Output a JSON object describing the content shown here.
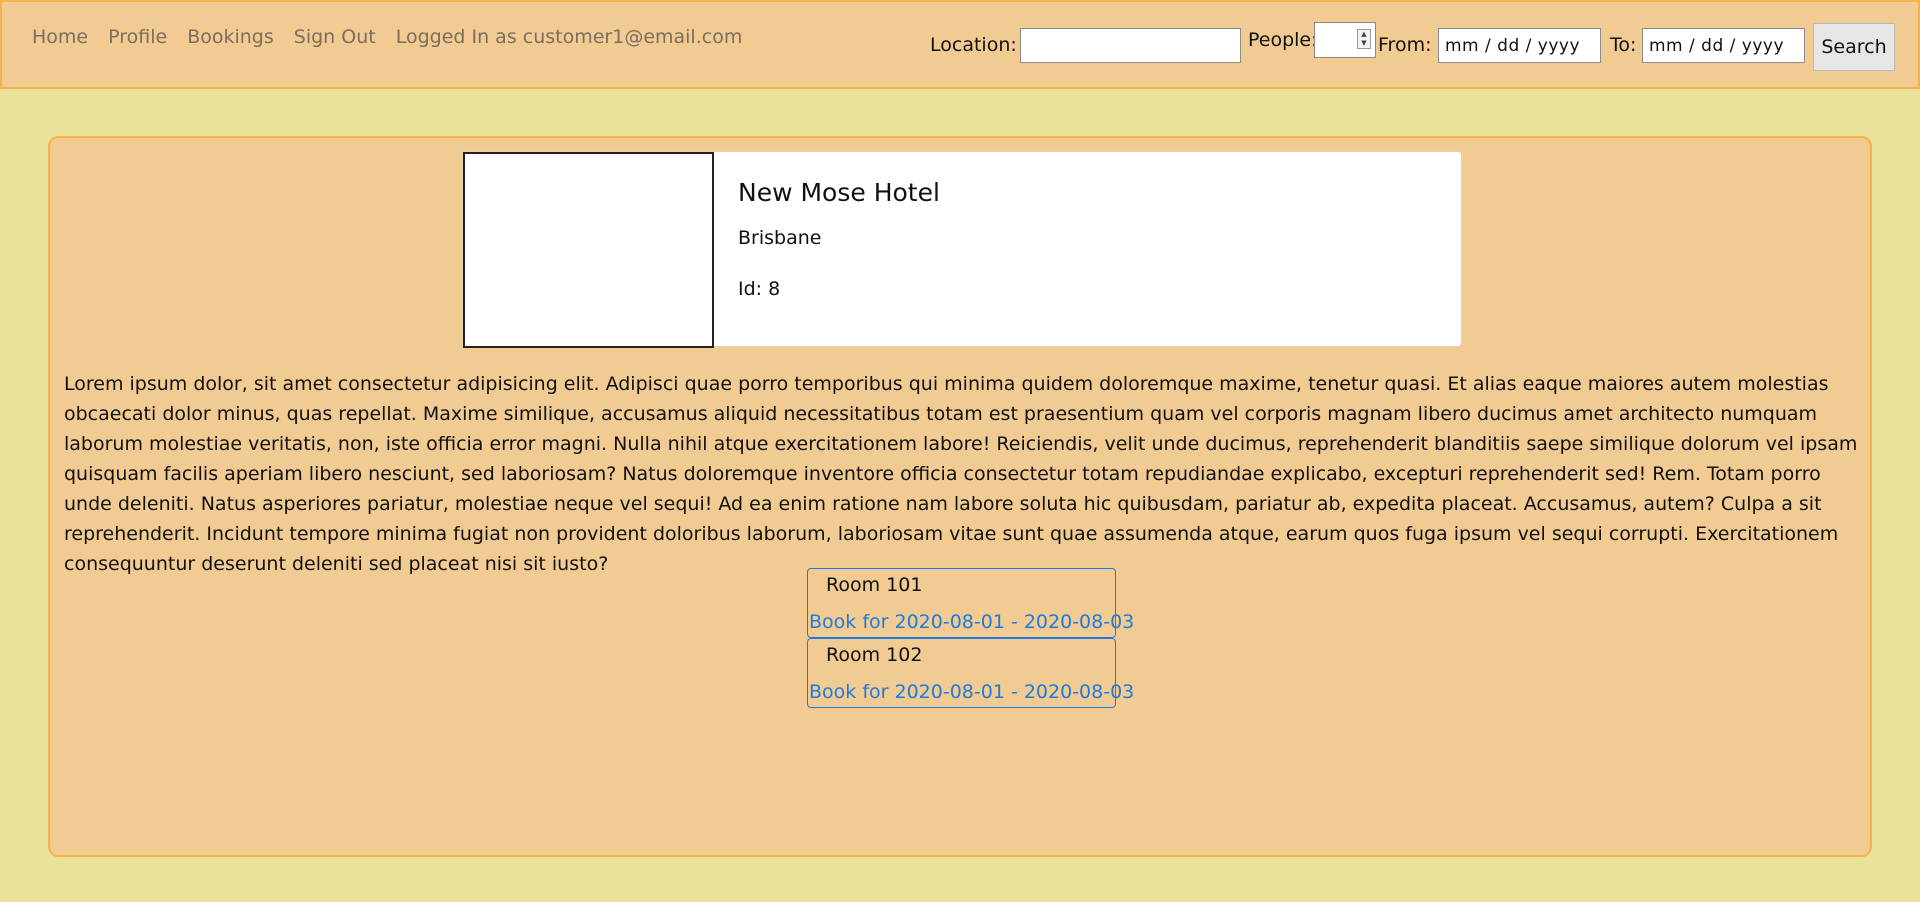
{
  "nav": {
    "links": [
      "Home",
      "Profile",
      "Bookings",
      "Sign Out"
    ],
    "status": "Logged In as customer1@email.com"
  },
  "search": {
    "location_label": "Location:",
    "location_value": "",
    "people_label": "People:",
    "people_value": "",
    "from_label": "From:",
    "from_placeholder": "mm / dd / yyyy",
    "to_label": "To:",
    "to_placeholder": "mm / dd / yyyy",
    "button_label": "Search"
  },
  "hotel": {
    "name": "New Mose Hotel",
    "location": "Brisbane",
    "id_text": "Id: 8",
    "description": "Lorem ipsum dolor, sit amet consectetur adipisicing elit. Adipisci quae porro temporibus qui minima quidem doloremque maxime, tenetur quasi. Et alias eaque maiores autem molestias obcaecati dolor minus, quas repellat. Maxime similique, accusamus aliquid necessitatibus totam est praesentium quam vel corporis magnam libero ducimus amet architecto numquam laborum molestiae veritatis, non, iste officia error magni. Nulla nihil atque exercitationem labore! Reiciendis, velit unde ducimus, reprehenderit blanditiis saepe similique dolorum vel ipsam quisquam facilis aperiam libero nesciunt, sed laboriosam? Natus doloremque inventore officia consectetur totam repudiandae explicabo, excepturi reprehenderit sed! Rem. Totam porro unde deleniti. Natus asperiores pariatur, molestiae neque vel sequi! Ad ea enim ratione nam labore soluta hic quibusdam, pariatur ab, expedita placeat. Accusamus, autem? Culpa a sit reprehenderit. Incidunt tempore minima fugiat non provident doloribus laborum, laboriosam vitae sunt quae assumenda atque, earum quos fuga ipsum vel sequi corrupti. Exercitationem consequuntur deserunt deleniti sed placeat nisi sit iusto?"
  },
  "rooms": [
    {
      "name": "Room 101",
      "book_label": "Book for 2020-08-01 - 2020-08-03"
    },
    {
      "name": "Room 102",
      "book_label": "Book for 2020-08-01 - 2020-08-03"
    }
  ],
  "colors": {
    "page_bg": "#e9e29a",
    "panel_bg": "#f2cb92",
    "panel_border": "#f7b24b",
    "link_blue": "#1d7be0",
    "nav_text": "#7b6d5f"
  },
  "icons": {
    "people_spinner": "spinner-arrows-icon",
    "hotel_image": "image-placeholder"
  }
}
